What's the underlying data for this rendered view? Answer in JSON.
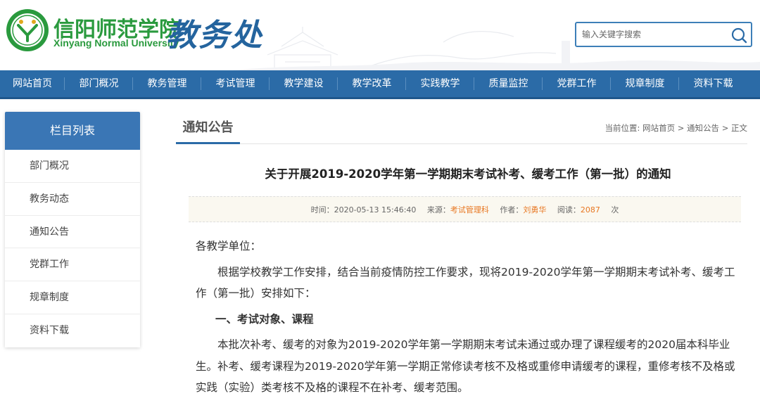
{
  "header": {
    "school_name_cn": "信阳师范学院",
    "school_name_en": "Xinyang Normal University",
    "dept_name": "教务处",
    "logo_icon": "university-seal-icon",
    "search": {
      "placeholder": "输入关键字搜索",
      "value": ""
    }
  },
  "nav": {
    "items": [
      {
        "label": "网站首页"
      },
      {
        "label": "部门概况"
      },
      {
        "label": "教务管理"
      },
      {
        "label": "考试管理"
      },
      {
        "label": "教学建设"
      },
      {
        "label": "教学改革"
      },
      {
        "label": "实践教学"
      },
      {
        "label": "质量监控"
      },
      {
        "label": "党群工作"
      },
      {
        "label": "规章制度"
      },
      {
        "label": "资料下载"
      }
    ]
  },
  "sidebar": {
    "title": "栏目列表",
    "items": [
      {
        "label": "部门概况"
      },
      {
        "label": "教务动态"
      },
      {
        "label": "通知公告"
      },
      {
        "label": "党群工作"
      },
      {
        "label": "规章制度"
      },
      {
        "label": "资料下载"
      }
    ]
  },
  "main": {
    "section_title": "通知公告",
    "breadcrumb": {
      "prefix": "当前位置:",
      "home": "网站首页",
      "sep": ">",
      "category": "通知公告",
      "current": "正文"
    },
    "article": {
      "title": "关于开展2019-2020学年第一学期期末考试补考、缓考工作（第一批）的通知",
      "meta": {
        "time_label": "时间：",
        "time_value": "2020-05-13 15:46:40",
        "source_label": "来源：",
        "source_value": "考试管理科",
        "author_label": "作者：",
        "author_value": "刘勇华",
        "views_label": "阅读：",
        "views_value": "2087",
        "views_unit": "次"
      },
      "salutation": "各教学单位：",
      "intro": "根据学校教学工作安排，结合当前疫情防控工作要求，现将2019-2020学年第一学期期末考试补考、缓考工作（第一批）安排如下：",
      "section1_heading": "一、考试对象、课程",
      "section1_body": "本批次补考、缓考的对象为2019-2020学年第一学期期末考试未通过或办理了课程缓考的2020届本科毕业生。补考、缓考课程为2019-2020学年第一学期正常修读考核不及格或重修申请缓考的课程，重修考核不及格或实践（实验）类考核不及格的课程不在补考、缓考范围。"
    }
  },
  "colors": {
    "nav_bg": "#2b6ba7",
    "sidebar_title_bg": "#3a76b5",
    "brand_green": "#2a9a3e",
    "dept_blue": "#24649e",
    "meta_highlight": "#e87722"
  }
}
